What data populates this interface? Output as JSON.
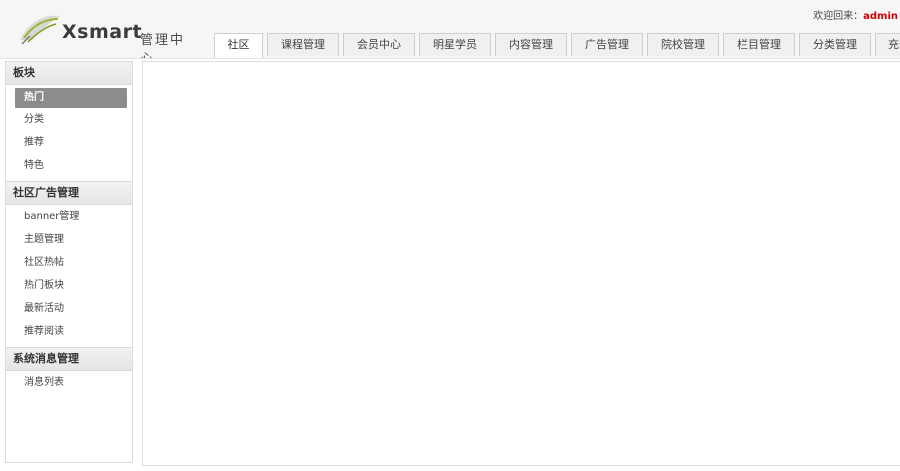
{
  "header": {
    "logo_text": "Xsmart",
    "logo_sub": "管理中心",
    "welcome_prefix": "欢迎回来：",
    "username": "admin",
    "tabs": [
      "社区",
      "课程管理",
      "会员中心",
      "明星学员",
      "内容管理",
      "广告管理",
      "院校管理",
      "栏目管理",
      "分类管理",
      "充值"
    ]
  },
  "sidebar": {
    "sections": [
      {
        "title": "板块",
        "items": [
          "热门",
          "分类",
          "推荐",
          "特色"
        ]
      },
      {
        "title": "社区广告管理",
        "items": [
          "banner管理",
          "主题管理",
          "社区热帖",
          "热门板块",
          "最新活动",
          "推荐阅读"
        ]
      },
      {
        "title": "系统消息管理",
        "items": [
          "消息列表"
        ]
      }
    ]
  },
  "colors": {
    "header_bg": "#f6f6f6",
    "active_item_bg": "#8c8c8c",
    "username": "#d40000"
  }
}
